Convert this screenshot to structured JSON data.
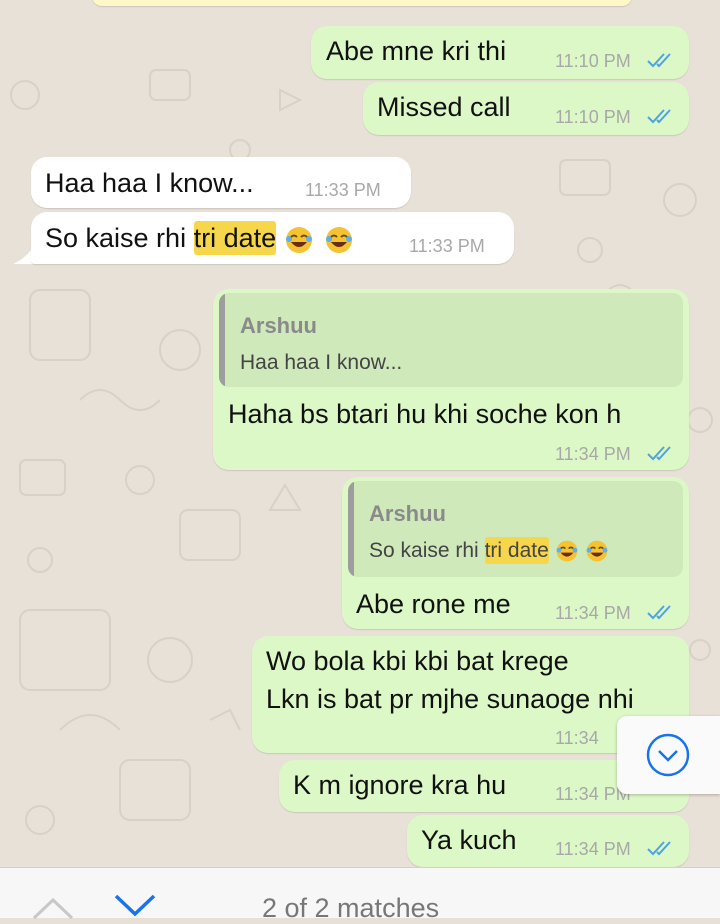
{
  "messages": [
    {
      "text": "Abe mne kri thi",
      "time": "11:10 PM"
    },
    {
      "text": "Missed call",
      "time": "11:10 PM"
    },
    {
      "text": "Haa haa  I know...",
      "time": "11:33 PM"
    },
    {
      "text_before": "So kaise rhi ",
      "highlight": "tri date",
      "time": "11:33 PM"
    },
    {
      "reply_author": "Arshuu",
      "reply_text": "Haa haa  I know...",
      "text": "Haha bs btari hu khi soche kon h",
      "time": "11:34 PM"
    },
    {
      "reply_author": "Arshuu",
      "reply_text_before": "So kaise rhi ",
      "reply_highlight": "tri date",
      "text": "Abe rone me",
      "time": "11:34 PM"
    },
    {
      "line1": "Wo bola kbi kbi bat krege",
      "line2": "Lkn is bat pr mjhe sunaoge nhi",
      "time": "11:34"
    },
    {
      "text": "K m ignore kra hu",
      "time": "11:34 PM"
    },
    {
      "text": "Ya kuch",
      "time": "11:34 PM"
    }
  ],
  "search": {
    "matches_label": "2 of 2 matches"
  },
  "colors": {
    "outgoing": "#dcf8c6",
    "incoming": "#ffffff",
    "highlight": "#f6d64a",
    "ticks": "#4fa3e0",
    "accent": "#1a73e8"
  },
  "icons": [
    "double-check-icon",
    "laughing-emoji-icon",
    "chevron-down-icon",
    "chevron-up-icon",
    "scroll-down-icon"
  ]
}
